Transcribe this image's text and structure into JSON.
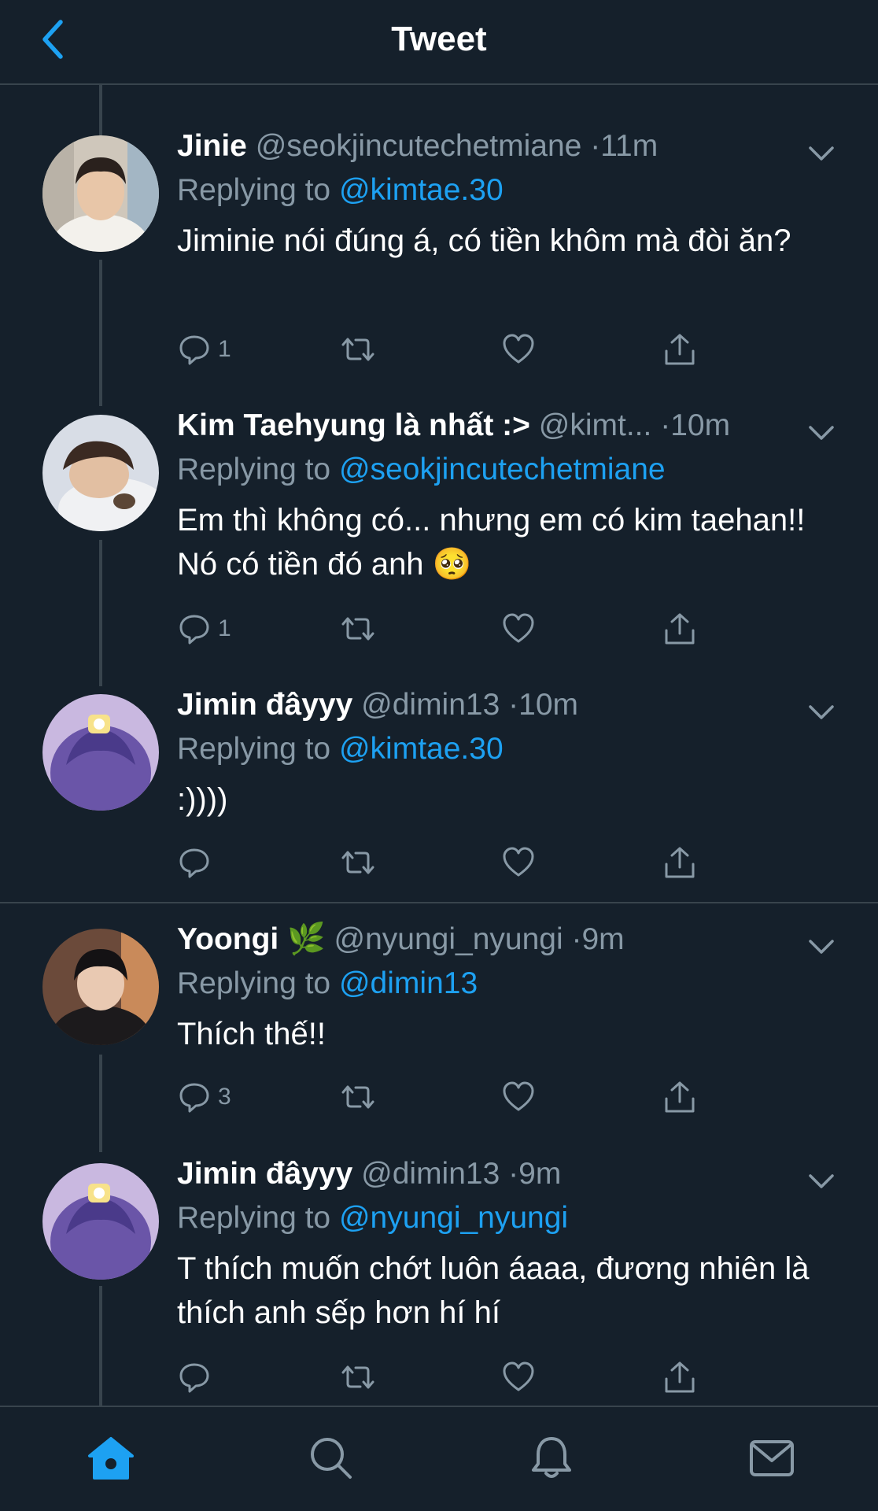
{
  "header": {
    "title": "Tweet",
    "back_icon": "chevron-left-icon"
  },
  "colors": {
    "background": "#15202b",
    "accent": "#1da1f2",
    "secondary_text": "#8899a6",
    "divider": "#38444d"
  },
  "tweets": [
    {
      "display_name": "Jinie",
      "handle": "@seokjincutechetmiane",
      "separator": "·",
      "time": "11m",
      "replying_prefix": "Replying to",
      "replying_to": "@kimtae.30",
      "text": "Jiminie nói đúng á, có tiền khôm mà đòi ăn?",
      "reply_count": "1"
    },
    {
      "display_name": "Kim Taehyung là nhất :>",
      "handle": "@kimt...",
      "separator": "·",
      "time": "10m",
      "replying_prefix": "Replying to",
      "replying_to": "@seokjincutechetmiane",
      "text": "Em thì không có... nhưng em có kim taehan!! Nó có tiền đó anh 🥺",
      "reply_count": "1"
    },
    {
      "display_name": "Jimin đâyyy",
      "handle": "@dimin13",
      "separator": "·",
      "time": "10m",
      "replying_prefix": "Replying to",
      "replying_to": "@kimtae.30",
      "text": ":))))",
      "reply_count": ""
    },
    {
      "display_name": "Yoongi 🌿",
      "handle": "@nyungi_nyungi",
      "separator": "·",
      "time": "9m",
      "replying_prefix": "Replying to",
      "replying_to": "@dimin13",
      "text": "Thích thế!!",
      "reply_count": "3"
    },
    {
      "display_name": "Jimin đâyyy",
      "handle": "@dimin13",
      "separator": "·",
      "time": "9m",
      "replying_prefix": "Replying to",
      "replying_to": "@nyungi_nyungi",
      "text": "T thích muốn chớt luôn áaaa, đương nhiên là thích anh sếp hơn hí hí",
      "reply_count": ""
    }
  ],
  "tabbar": {
    "items": [
      "home-icon",
      "search-icon",
      "bell-icon",
      "mail-icon"
    ],
    "active": "home-icon"
  }
}
